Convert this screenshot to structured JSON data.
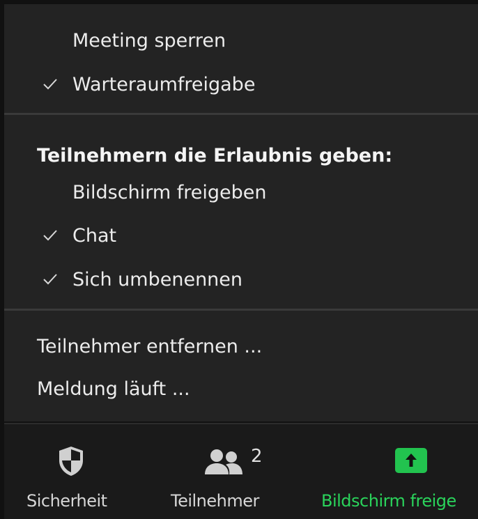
{
  "menu": {
    "lock_meeting": {
      "label": "Meeting sperren",
      "checked": false
    },
    "waiting_room": {
      "label": "Warteraumfreigabe",
      "checked": true
    },
    "permissions_heading": "Teilnehmern die Erlaubnis geben:",
    "share_screen": {
      "label": "Bildschirm freigeben",
      "checked": false
    },
    "chat": {
      "label": "Chat",
      "checked": true
    },
    "rename": {
      "label": "Sich umbenennen",
      "checked": true
    },
    "remove_participant": {
      "label": "Teilnehmer entfernen ..."
    },
    "report": {
      "label": "Meldung läuft ..."
    }
  },
  "toolbar": {
    "security": {
      "label": "Sicherheit",
      "icon": "shield-icon"
    },
    "participants": {
      "label": "Teilnehmer",
      "icon": "participants-icon",
      "count": "2"
    },
    "share": {
      "label": "Bildschirm freige",
      "icon": "share-screen-icon"
    }
  },
  "colors": {
    "menu_bg": "#232323",
    "toolbar_bg": "#1a1a1a",
    "accent_green": "#2ad35b",
    "share_button_green": "#22c34f"
  }
}
